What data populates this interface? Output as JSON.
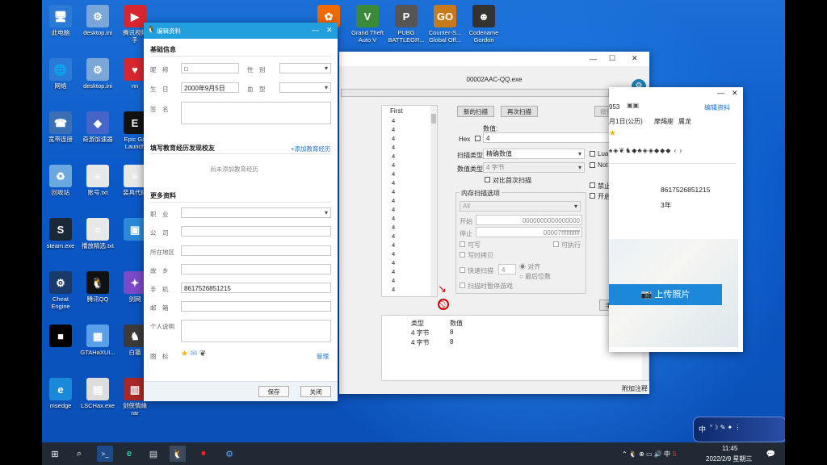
{
  "desktop": {
    "icons": [
      {
        "label": "此电脑",
        "glyph": "🖥"
      },
      {
        "label": "desktop.ini",
        "glyph": "⚙"
      },
      {
        "label": "腾讯视频\n手",
        "glyph": "▶"
      },
      {
        "label": "网络",
        "glyph": "🌐"
      },
      {
        "label": "desktop.ini",
        "glyph": "⚙"
      },
      {
        "label": "nn",
        "glyph": "♥"
      },
      {
        "label": "宽带连接",
        "glyph": "☎"
      },
      {
        "label": "奇游加速器",
        "glyph": "◆"
      },
      {
        "label": "Epic Ga\nLaunch",
        "glyph": "E"
      },
      {
        "label": "回收站",
        "glyph": "♻"
      },
      {
        "label": "账号.txt",
        "glyph": "≡"
      },
      {
        "label": "装具代码",
        "glyph": "≡"
      },
      {
        "label": "steam.exe",
        "glyph": "S"
      },
      {
        "label": "播放精选.txt",
        "glyph": "≡"
      },
      {
        "label": "",
        "glyph": "▣"
      },
      {
        "label": "Cheat\nEngine",
        "glyph": "⚙"
      },
      {
        "label": "腾讯QQ",
        "glyph": "🐧"
      },
      {
        "label": "剑网",
        "glyph": "✦"
      },
      {
        "label": "",
        "glyph": "■"
      },
      {
        "label": "GTAHaXUI...",
        "glyph": "▦"
      },
      {
        "label": "白猫",
        "glyph": "♞"
      },
      {
        "label": "msedge",
        "glyph": "e"
      },
      {
        "label": "LSCHax.exe",
        "glyph": "▤"
      },
      {
        "label": "剑侠情缘\nrar",
        "glyph": "▥"
      }
    ],
    "top_icons": [
      {
        "label": "G...",
        "glyph": "✿"
      },
      {
        "label": "Grand Theft\nAuto V",
        "glyph": "V"
      },
      {
        "label": "PUBG\nBATTLEGR...",
        "glyph": "P"
      },
      {
        "label": "Counter-S...\nGlobal Off...",
        "glyph": "GO"
      },
      {
        "label": "Codename\nGordon",
        "glyph": "☻"
      }
    ]
  },
  "profile_dialog": {
    "title": "编辑资料",
    "minimize": "—",
    "close": "✕",
    "section_basic": "基础信息",
    "nickname_label": "昵　称",
    "nickname_value": "□",
    "gender_label": "性　别",
    "birthday_label": "生　日",
    "birthday_value": "2000年9月5日",
    "blood_label": "血　型",
    "signature_label": "签　名",
    "section_edu": "填写教育经历发现校友",
    "add_edu": "+添加教育经历",
    "no_edu": "尚未添加教育经历",
    "section_more": "更多资料",
    "job_label": "职　业",
    "company_label": "公　司",
    "location_label": "所在地区",
    "hometown_label": "故　乡",
    "phone_label": "手　机",
    "phone_value": "8617526851215",
    "email_label": "邮　箱",
    "bio_label": "个人说明",
    "icon_label": "图　标",
    "manage": "管理",
    "save": "保存",
    "close_btn": "关闭"
  },
  "cheat_engine": {
    "title": "00002AAC-QQ.exe",
    "settings": "设置",
    "list_header": "First",
    "list_values": [
      "4",
      "4",
      "4",
      "4",
      "4",
      "4",
      "4",
      "4",
      "4",
      "4",
      "4",
      "4",
      "4",
      "4",
      "4",
      "4",
      "4",
      "4",
      "4",
      "4",
      "4",
      "4",
      "4",
      "4",
      "4",
      "4",
      "4",
      "4",
      "4",
      "4",
      "4",
      "4",
      "4",
      "4",
      "4",
      "4",
      "4",
      "4",
      "4",
      "4",
      "4"
    ],
    "new_scan": "新的扫描",
    "next_scan": "再次扫描",
    "undo_scan": "撤销扫描",
    "value_label": "数值:",
    "hex_label": "Hex",
    "value": "4",
    "scan_type_label": "扫描类型",
    "scan_type": "精确数值",
    "value_type_label": "数值类型",
    "value_type": "4 字节",
    "compare_first": "对比首次扫描",
    "lua_formula": "Lua formula",
    "not_label": "Not",
    "mem_options": "内存扫描选项",
    "mem_all": "All",
    "start_label": "开始",
    "start_value": "0000000000000000",
    "stop_label": "停止",
    "stop_value": "00007fffffffffff",
    "writable": "可写",
    "executable": "可执行",
    "copy_on_write": "写时拷贝",
    "fast_scan": "快速扫描",
    "fast_value": "4",
    "align": "对齐",
    "last_digit": "最后位数",
    "pause_game": "扫描时暂停游戏",
    "disable_random": "禁止随机",
    "speedhack": "开启变速精灵",
    "add_address": "手动添加地址",
    "col_type": "类型",
    "col_value": "数值",
    "rows": [
      {
        "type": "4 字节",
        "value": "8"
      },
      {
        "type": "4 字节",
        "value": "8"
      }
    ],
    "add_comment": "附加注释",
    "win_min": "—",
    "win_max": "☐",
    "win_close": "✕"
  },
  "qq_panel": {
    "id_partial": "953",
    "edit_profile": "编辑资料",
    "birthday_partial": "月1日(公历)",
    "zodiac": "摩羯座",
    "animal": "属龙",
    "phone": "8617526851215",
    "years": "3年",
    "upload_photo": "上传照片",
    "min": "—",
    "close": "✕"
  },
  "taskbar": {
    "time": "11:45",
    "date": "2022/2/9 星期三",
    "ime": "中",
    "notification_count": "6"
  },
  "ime_widget": {
    "label": "中"
  }
}
